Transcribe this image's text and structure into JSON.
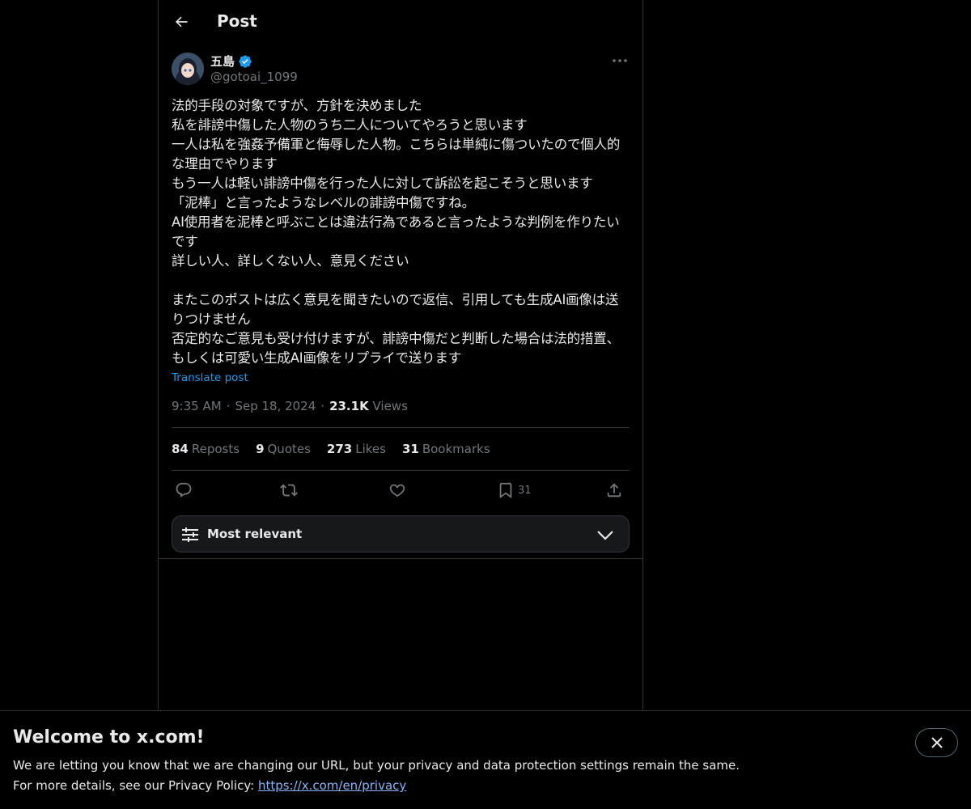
{
  "header": {
    "title": "Post"
  },
  "author": {
    "display_name": "五島",
    "handle": "@gotoai_1099",
    "verified_color": "#1d9bf0"
  },
  "post": {
    "text": "法的手段の対象ですが、方針を決めました\n私を誹謗中傷した人物のうち二人についてやろうと思います\n一人は私を強姦予備軍と侮辱した人物。こちらは単純に傷ついたので個人的な理由でやります\nもう一人は軽い誹謗中傷を行った人に対して訴訟を起こそうと思います\n「泥棒」と言ったようなレベルの誹謗中傷ですね。\nAI使用者を泥棒と呼ぶことは違法行為であると言ったような判例を作りたいです\n詳しい人、詳しくない人、意見ください\n\nまたこのポストは広く意見を聞きたいので返信、引用しても生成AI画像は送りつけません\n否定的なご意見も受け付けますが、誹謗中傷だと判断した場合は法的措置、もしくは可愛い生成AI画像をリプライで送ります",
    "translate_label": "Translate post",
    "time": "9:35 AM",
    "date": "Sep 18, 2024",
    "views_count": "23.1K",
    "views_label": "Views",
    "separator": "·"
  },
  "stats": {
    "reposts": {
      "count": "84",
      "label": "Reposts"
    },
    "quotes": {
      "count": "9",
      "label": "Quotes"
    },
    "likes": {
      "count": "273",
      "label": "Likes"
    },
    "bookmarks": {
      "count": "31",
      "label": "Bookmarks"
    }
  },
  "actions": {
    "reply": {
      "icon": "reply-icon"
    },
    "repost": {
      "icon": "repost-icon"
    },
    "like": {
      "icon": "heart-icon"
    },
    "bookmark": {
      "icon": "bookmark-icon",
      "count": "31"
    },
    "share": {
      "icon": "share-icon"
    }
  },
  "sort": {
    "label": "Most relevant"
  },
  "banner": {
    "title": "Welcome to x.com!",
    "line1": "We are letting you know that we are changing our URL, but your privacy and data protection settings remain the same.",
    "line2_prefix": "For more details, see our Privacy Policy: ",
    "link": "https://x.com/en/privacy"
  }
}
